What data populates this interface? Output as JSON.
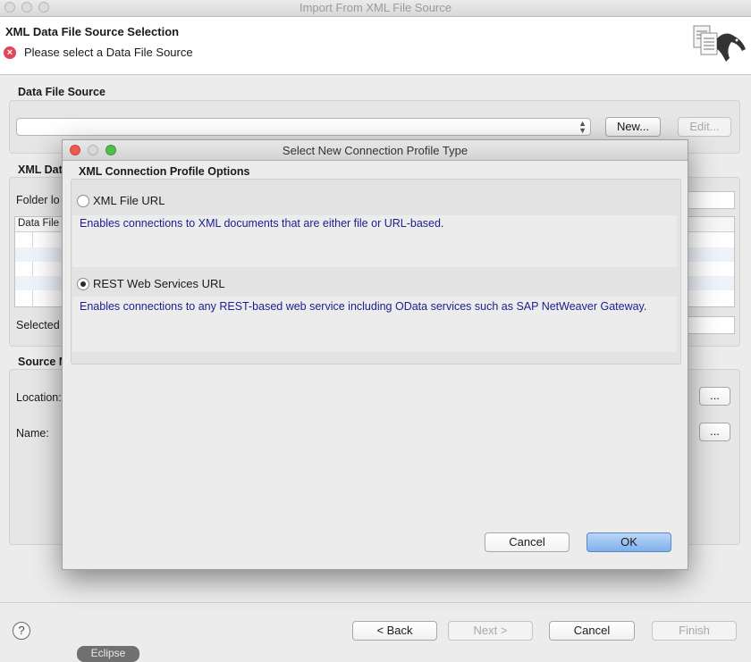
{
  "window": {
    "title": "Import From XML File Source"
  },
  "wizard": {
    "title": "XML Data File Source Selection",
    "message": "Please select a Data File Source",
    "data_file_source_label": "Data File Source",
    "new_button": "New...",
    "edit_button": "Edit...",
    "xml_data_group_label_partial": "XML Dat",
    "folder_label_partial": "Folder lo",
    "table_header_partial": "Data File",
    "selected_label_partial": "Selected",
    "source_group_label_partial": "Source N",
    "location_label": "Location:",
    "name_label": "Name:",
    "browse_button": "...",
    "back_button": "< Back",
    "next_button": "Next >",
    "cancel_button": "Cancel",
    "finish_button": "Finish",
    "eclipse_tag": "Eclipse"
  },
  "dialog": {
    "title": "Select New Connection Profile Type",
    "section_label": "XML Connection Profile Options",
    "options": [
      {
        "label": "XML File URL",
        "description": "Enables connections to XML documents that are either file or URL-based.",
        "selected": false
      },
      {
        "label": "REST Web Services URL",
        "description": "Enables connections to any REST-based web service including OData services such as SAP NetWeaver Gateway.",
        "selected": true
      }
    ],
    "cancel_button": "Cancel",
    "ok_button": "OK"
  },
  "colors": {
    "error": "#e0465a",
    "description_text": "#1d1d8f",
    "ok_button": "#7fb0ec"
  }
}
